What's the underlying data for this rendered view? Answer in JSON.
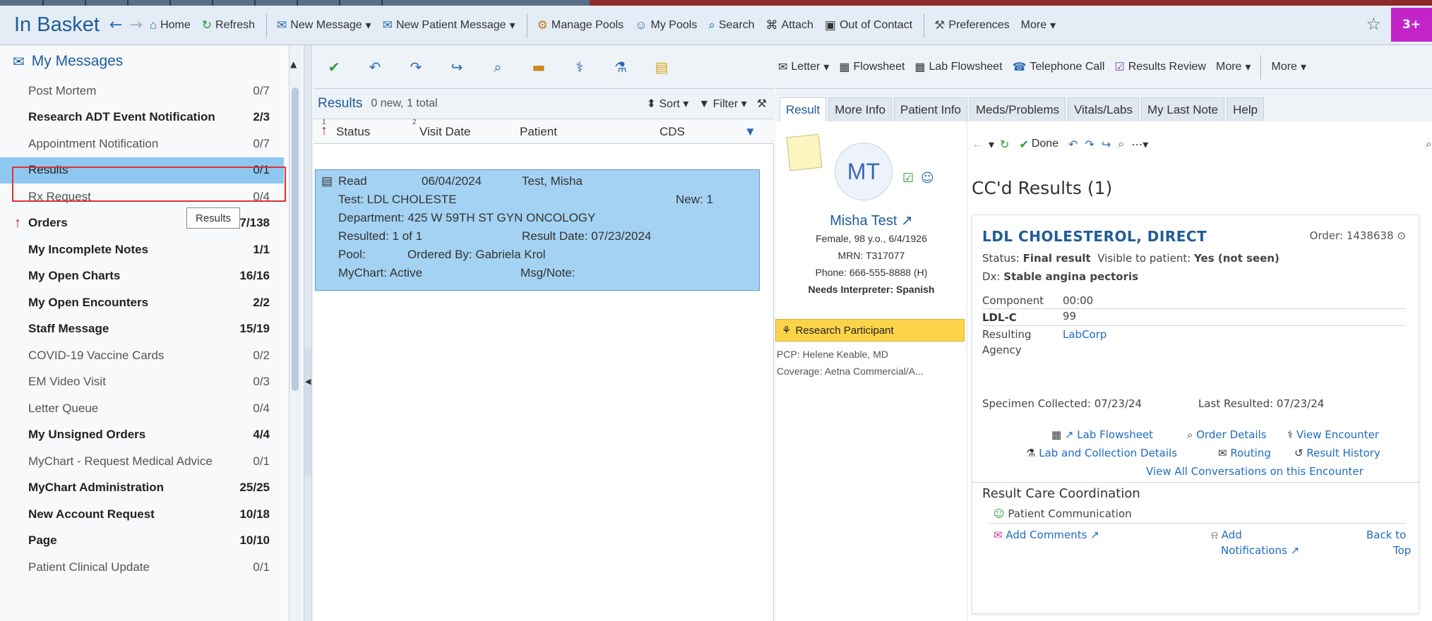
{
  "toolbar": {
    "title": "In Basket",
    "home": "Home",
    "refresh": "Refresh",
    "new_message": "New Message",
    "new_patient_message": "New Patient Message",
    "manage_pools": "Manage Pools",
    "my_pools": "My Pools",
    "search": "Search",
    "attach": "Attach",
    "out_of_contact": "Out of Contact",
    "preferences": "Preferences",
    "more": "More",
    "badge": "3+"
  },
  "sidebar": {
    "header": "My Messages",
    "tooltip": "Results",
    "items": [
      {
        "label": "Post Mortem",
        "count": "0/7",
        "bold": false
      },
      {
        "label": "Research ADT Event Notification",
        "count": "2/3",
        "bold": true
      },
      {
        "label": "Appointment Notification",
        "count": "0/7",
        "bold": false
      },
      {
        "label": "Results",
        "count": "0/1",
        "bold": false,
        "selected": true
      },
      {
        "label": "Rx Request",
        "count": "0/4",
        "bold": false
      },
      {
        "label": "Orders",
        "count": "137/138",
        "bold": true,
        "flag": true
      },
      {
        "label": "My Incomplete Notes",
        "count": "1/1",
        "bold": true
      },
      {
        "label": "My Open Charts",
        "count": "16/16",
        "bold": true
      },
      {
        "label": "My Open Encounters",
        "count": "2/2",
        "bold": true
      },
      {
        "label": "Staff Message",
        "count": "15/19",
        "bold": true
      },
      {
        "label": "COVID-19 Vaccine Cards",
        "count": "0/2",
        "bold": false
      },
      {
        "label": "EM Video Visit",
        "count": "0/3",
        "bold": false
      },
      {
        "label": "Letter Queue",
        "count": "0/4",
        "bold": false
      },
      {
        "label": "My Unsigned Orders",
        "count": "4/4",
        "bold": true
      },
      {
        "label": "MyChart - Request Medical Advice",
        "count": "0/1",
        "bold": false
      },
      {
        "label": "MyChart Administration",
        "count": "25/25",
        "bold": true
      },
      {
        "label": "New Account Request",
        "count": "10/18",
        "bold": true
      },
      {
        "label": "Page",
        "count": "10/10",
        "bold": true
      },
      {
        "label": "Patient Clinical Update",
        "count": "0/1",
        "bold": false
      }
    ]
  },
  "results_panel": {
    "title": "Results",
    "summary": "0 new, 1 total",
    "sort": "Sort",
    "filter": "Filter",
    "columns": [
      "Status",
      "Visit Date",
      "Patient",
      "CDS"
    ],
    "sort_numbers": [
      "1",
      "2"
    ],
    "row": {
      "status": "Read",
      "visit_date": "06/04/2024",
      "patient": "Test, Misha",
      "test": "Test: LDL CHOLESTE",
      "new": "New: 1",
      "department": "Department: 425 W 59TH ST GYN ONCOLOGY",
      "resulted": "Resulted: 1 of 1",
      "result_date": "Result Date: 07/23/2024",
      "pool": "Pool:",
      "ordered_by": "Ordered By: Gabriela Krol",
      "mychart": "MyChart: Active",
      "msg_note": "Msg/Note:"
    }
  },
  "right_toolbar": {
    "letter": "Letter",
    "flowsheet": "Flowsheet",
    "lab_flowsheet": "Lab Flowsheet",
    "telephone_call": "Telephone Call",
    "results_review": "Results Review",
    "more1": "More",
    "more2": "More"
  },
  "tabs": [
    "Result",
    "More Info",
    "Patient Info",
    "Meds/Problems",
    "Vitals/Labs",
    "My Last Note",
    "Help"
  ],
  "patient": {
    "initials": "MT",
    "name": "Misha Test",
    "demo": "Female, 98 y.o., 6/4/1926",
    "mrn": "MRN: T317077",
    "phone": "Phone: 666-555-8888 (H)",
    "interpreter": "Needs Interpreter: Spanish",
    "research": "Research Participant",
    "pcp": "PCP: Helene Keable, MD",
    "coverage": "Coverage: Aetna Commercial/A..."
  },
  "result": {
    "done": "Done",
    "heading": "CC'd Results (1)",
    "test_name": "LDL CHOLESTEROL, DIRECT",
    "order": "Order: 1438638",
    "status_label": "Status:",
    "status_value": "Final result",
    "visible_label": "Visible to patient:",
    "visible_value": "Yes (not seen)",
    "dx_label": "Dx:",
    "dx_value": "Stable angina pectoris",
    "component_label": "Component",
    "component_time": "00:00",
    "ldl_label": "LDL-C",
    "ldl_value": "99",
    "resulting_agency_1": "Resulting",
    "resulting_agency_2": "Agency",
    "agency_value": "LabCorp",
    "specimen": "Specimen Collected: 07/23/24",
    "last_resulted": "Last Resulted: 07/23/24",
    "link_lab_flowsheet": "Lab Flowsheet",
    "link_order_details": "Order Details",
    "link_view_encounter": "View Encounter",
    "link_lab_collection": "Lab and Collection Details",
    "link_routing": "Routing",
    "link_result_history": "Result History",
    "link_view_all": "View All Conversations on this Encounter",
    "care_coord": "Result Care Coordination",
    "patient_comm": "Patient Communication",
    "add_comments": "Add Comments",
    "add_notif_1": "Add",
    "add_notif_2": "Notifications",
    "back_1": "Back to",
    "back_2": "Top"
  },
  "colors": {
    "accent": "#1f5c99",
    "selected_bg": "#8ec8f0",
    "row_bg": "#a4d2f2",
    "badge": "#c224c8",
    "research": "#fbd44a"
  }
}
